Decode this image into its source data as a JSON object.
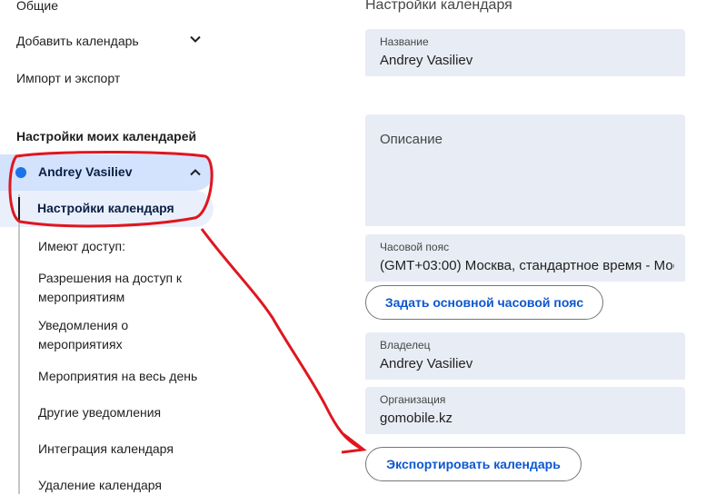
{
  "sidebar": {
    "general": "Общие",
    "add_calendar": "Добавить календарь",
    "import_export": "Импорт и экспорт",
    "my_calendars_heading": "Настройки моих календарей",
    "calendar_name": "Andrey Vasiliev",
    "calendar_dot_color": "#1a73e8",
    "items": [
      {
        "label": "Настройки календаря"
      },
      {
        "label": "Имеют доступ:"
      },
      {
        "label": "Разрешения на доступ к мероприятиям"
      },
      {
        "label": "Уведомления о мероприятиях"
      },
      {
        "label": "Мероприятия на весь день"
      },
      {
        "label": "Другие уведомления"
      },
      {
        "label": "Интеграция календаря"
      },
      {
        "label": "Удаление календаря"
      }
    ]
  },
  "main": {
    "section_title": "Настройки календаря",
    "name_field": {
      "label": "Название",
      "value": "Andrey Vasiliev"
    },
    "description_field": {
      "placeholder": "Описание"
    },
    "timezone_field": {
      "label": "Часовой пояс",
      "value": "(GMT+03:00) Москва, стандартное время - Моск"
    },
    "set_primary_tz_button": "Задать основной часовой пояс",
    "owner_field": {
      "label": "Владелец",
      "value": "Andrey Vasiliev"
    },
    "organization_field": {
      "label": "Организация",
      "value": "gomobile.kz"
    },
    "export_button": "Экспортировать календарь"
  },
  "colors": {
    "accent": "#0b57d0",
    "selected_bg": "#d3e3fd",
    "field_bg": "#e8ecf4",
    "annotation": "#e0161f"
  }
}
